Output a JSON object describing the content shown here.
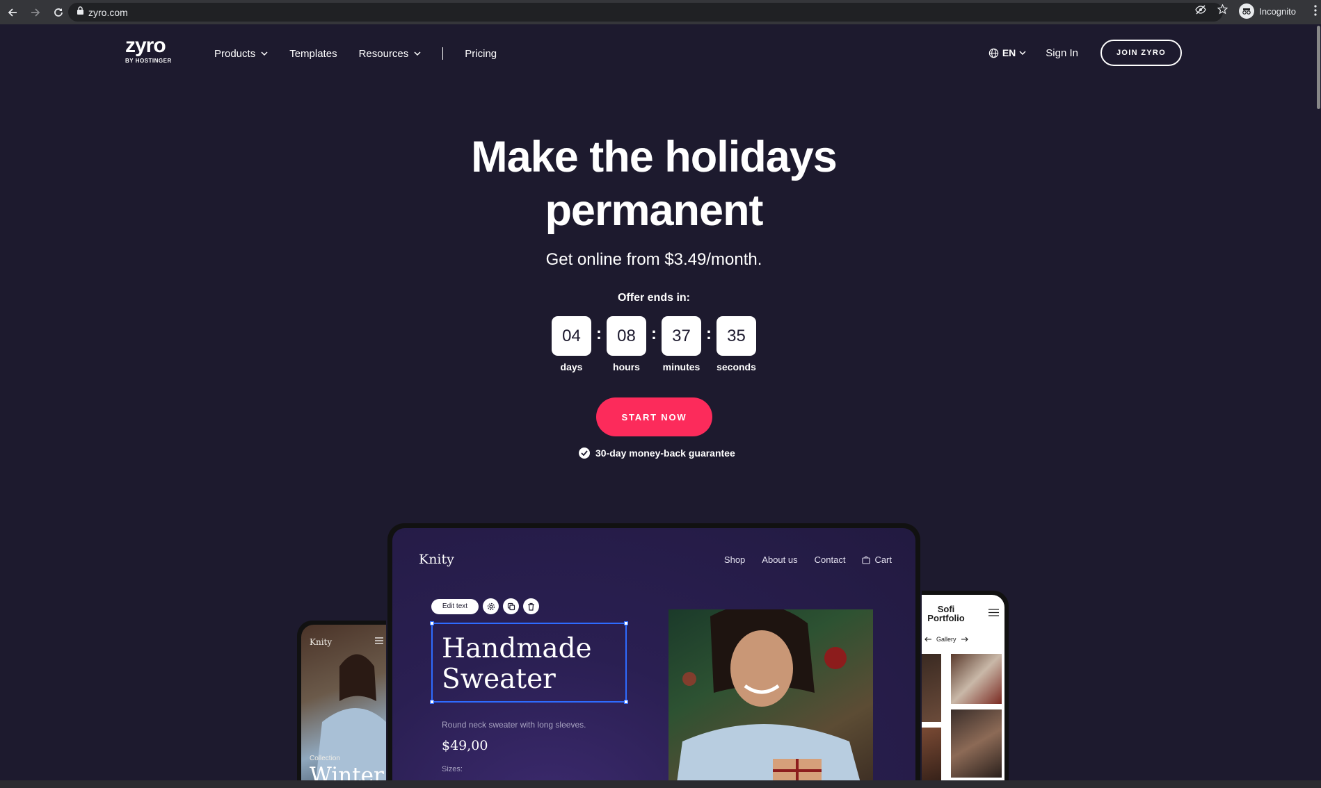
{
  "browser": {
    "url": "zyro.com",
    "profile_label": "Incognito"
  },
  "header": {
    "logo_text": "zyro",
    "logo_sub": "BY HOSTINGER",
    "nav": [
      "Products",
      "Templates",
      "Resources",
      "Pricing"
    ],
    "language": "EN",
    "signin": "Sign In",
    "join": "JOIN ZYRO"
  },
  "hero": {
    "title_line1": "Make the holidays",
    "title_line2": "permanent",
    "subtitle": "Get online from $3.49/month.",
    "offer_label": "Offer ends in:",
    "countdown": [
      {
        "value": "04",
        "label": "days"
      },
      {
        "value": "08",
        "label": "hours"
      },
      {
        "value": "37",
        "label": "minutes"
      },
      {
        "value": "35",
        "label": "seconds"
      }
    ],
    "cta": "START NOW",
    "guarantee": "30-day money-back guarantee"
  },
  "mockup": {
    "brand": "Knity",
    "nav": [
      "Shop",
      "About us",
      "Contact",
      "Cart"
    ],
    "edit_label": "Edit text",
    "product_title_line1": "Handmade",
    "product_title_line2": "Sweater",
    "product_desc": "Round neck sweater with long sleeves.",
    "price": "$49,00",
    "sizes_label": "Sizes:",
    "phone_left": {
      "brand": "Knity",
      "collection": "Collection",
      "title": "Winter"
    },
    "phone_right": {
      "title_line1": "Sofi",
      "title_line2": "Portfolio",
      "gallery": "Gallery"
    }
  },
  "colors": {
    "background": "#1d1a2e",
    "accent": "#fc2b5b",
    "selection": "#2e6bff"
  }
}
